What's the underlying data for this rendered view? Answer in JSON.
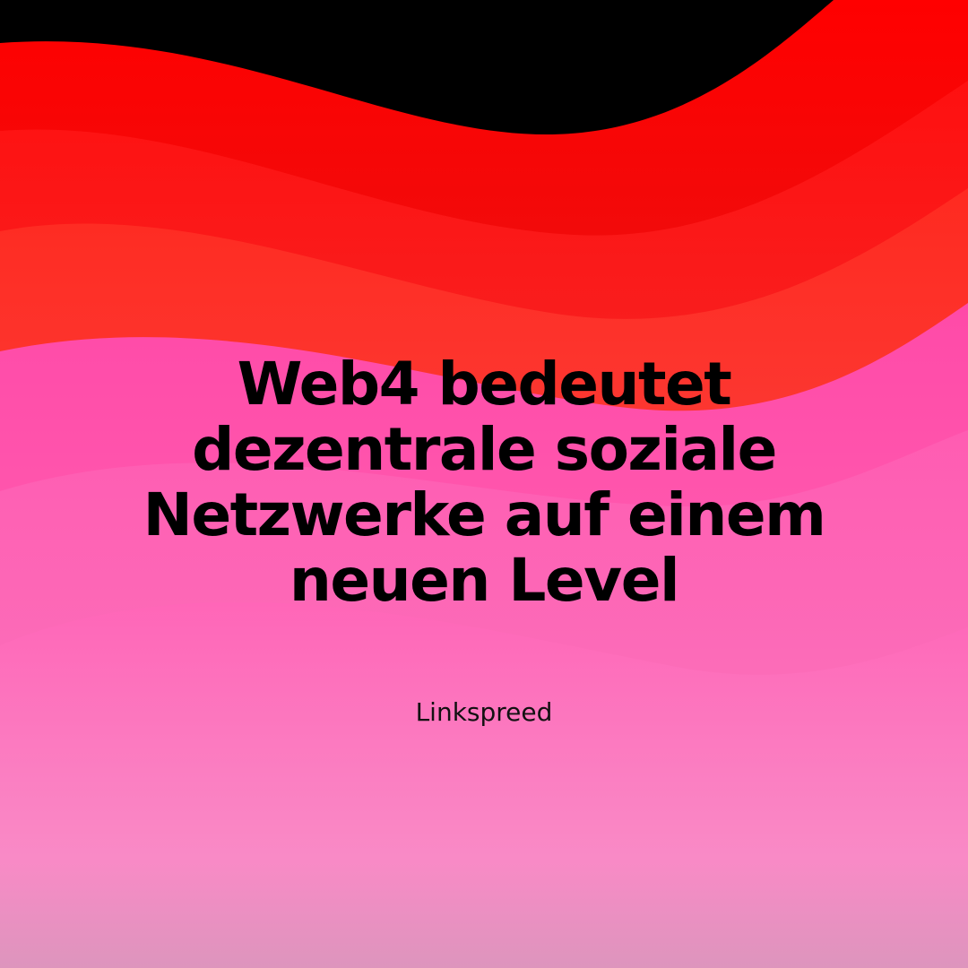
{
  "headline": {
    "line1": "Web4 bedeutet",
    "line2": "dezentrale soziale",
    "line3": "Netzwerke auf einem",
    "line4": "neuen Level"
  },
  "brand": "Linkspreed",
  "colors": {
    "black": "#000000",
    "red": "#ff0000",
    "dark_red": "#c62828",
    "pink": "#ff4fb8",
    "light_pink": "#f77fc3",
    "mauve": "#e290bd"
  }
}
